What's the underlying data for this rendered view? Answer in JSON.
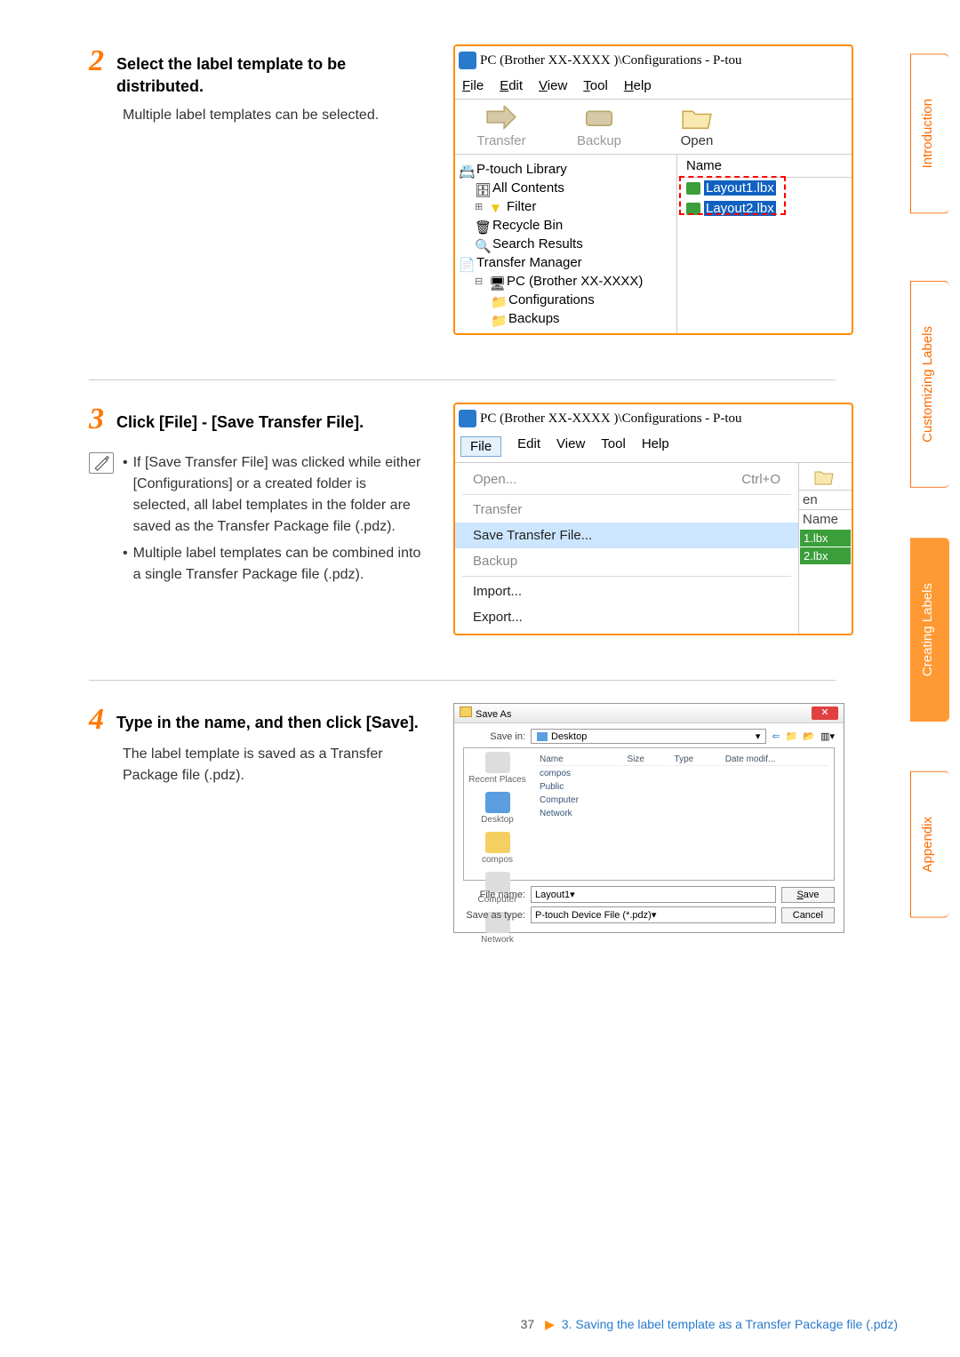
{
  "step2": {
    "title": "Select the label template to be distributed.",
    "subtext": "Multiple label templates can be selected."
  },
  "step3": {
    "title": "Click [File] - [Save Transfer File].",
    "note1": "If [Save Transfer File] was clicked while either [Configurations] or a created folder is selected, all label templates in the folder are saved as the Transfer Package file (.pdz).",
    "note2": "Multiple label templates can be combined into a single Transfer Package file (.pdz)."
  },
  "step4": {
    "title": "Type in the name, and then click [Save].",
    "subtext": "The label template is saved as a Transfer Package file (.pdz)."
  },
  "win_common": {
    "title_text": "PC (Brother XX-XXXX )\\Configurations - P-tou",
    "menu_file": "File",
    "menu_edit": "Edit",
    "menu_view": "View",
    "menu_tool": "Tool",
    "menu_help": "Help",
    "tool_transfer": "Transfer",
    "tool_backup": "Backup",
    "tool_open": "Open"
  },
  "win1": {
    "tree": {
      "ptouch": "P-touch Library",
      "all": "All Contents",
      "filter": "Filter",
      "recycle": "Recycle Bin",
      "search": "Search Results",
      "transfer_mgr": "Transfer Manager",
      "pc": "PC (Brother XX-XXXX)",
      "config": "Configurations",
      "backups": "Backups"
    },
    "list_head": "Name",
    "list_r1": "Layout1.lbx",
    "list_r2": "Layout2.lbx"
  },
  "win2": {
    "menu_open": "Open...",
    "menu_open_sc": "Ctrl+O",
    "menu_transfer": "Transfer",
    "menu_save_transfer": "Save Transfer File...",
    "menu_backup": "Backup",
    "menu_import": "Import...",
    "menu_export": "Export...",
    "side_en": "en",
    "side_name": "Name",
    "side_1": "1.lbx",
    "side_2": "2.lbx"
  },
  "saveas": {
    "title": "Save As",
    "savein_label": "Save in:",
    "savein_value": "Desktop",
    "cols": {
      "name": "Name",
      "size": "Size",
      "type": "Type",
      "date": "Date modif..."
    },
    "items": {
      "compos": "compos",
      "public": "Public",
      "computer": "Computer",
      "network": "Network"
    },
    "places": {
      "recent": "Recent Places",
      "desktop": "Desktop",
      "compos": "compos",
      "computer": "Computer",
      "network": "Network"
    },
    "filename_label": "File name:",
    "filename_value": "Layout1",
    "type_label": "Save as type:",
    "type_value": "P-touch Device File (*.pdz)",
    "btn_save": "Save",
    "btn_cancel": "Cancel"
  },
  "tabs": {
    "intro": "Introduction",
    "custom": "Customizing Labels",
    "creating": "Creating Labels",
    "appendix": "Appendix"
  },
  "footer": {
    "page": "37",
    "text": "3. Saving the label template as a Transfer Package file (.pdz)"
  }
}
